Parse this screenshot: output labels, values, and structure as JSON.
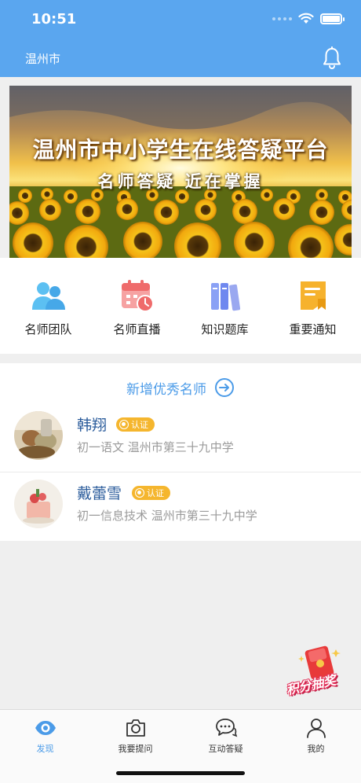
{
  "status_bar": {
    "time": "10:51"
  },
  "header": {
    "city": "温州市"
  },
  "banner": {
    "title": "温州市中小学生在线答疑平台",
    "subtitle": "名师答疑 近在掌握"
  },
  "quick_actions": [
    {
      "label": "名师团队",
      "icon": "teachers-team-icon"
    },
    {
      "label": "名师直播",
      "icon": "calendar-live-icon"
    },
    {
      "label": "知识题库",
      "icon": "books-icon"
    },
    {
      "label": "重要通知",
      "icon": "notice-bookmark-icon"
    }
  ],
  "teachers_section": {
    "title": "新增优秀名师",
    "teachers": [
      {
        "name": "韩翔",
        "badge": "认证",
        "info": "初一语文  温州市第三十九中学"
      },
      {
        "name": "戴蕾雪",
        "badge": "认证",
        "info": "初一信息技术  温州市第三十九中学"
      }
    ]
  },
  "floating_promo": {
    "label": "积分抽奖"
  },
  "tab_bar": {
    "tabs": [
      {
        "label": "发现",
        "icon": "eye-icon",
        "active": true
      },
      {
        "label": "我要提问",
        "icon": "camera-icon",
        "active": false
      },
      {
        "label": "互动答疑",
        "icon": "chat-icon",
        "active": false
      },
      {
        "label": "我的",
        "icon": "person-icon",
        "active": false
      }
    ]
  },
  "colors": {
    "primary": "#5aa6ef",
    "link": "#4b9be8",
    "name": "#2c5d9c",
    "badge": "#f5b62e",
    "muted": "#9a9a9a"
  }
}
